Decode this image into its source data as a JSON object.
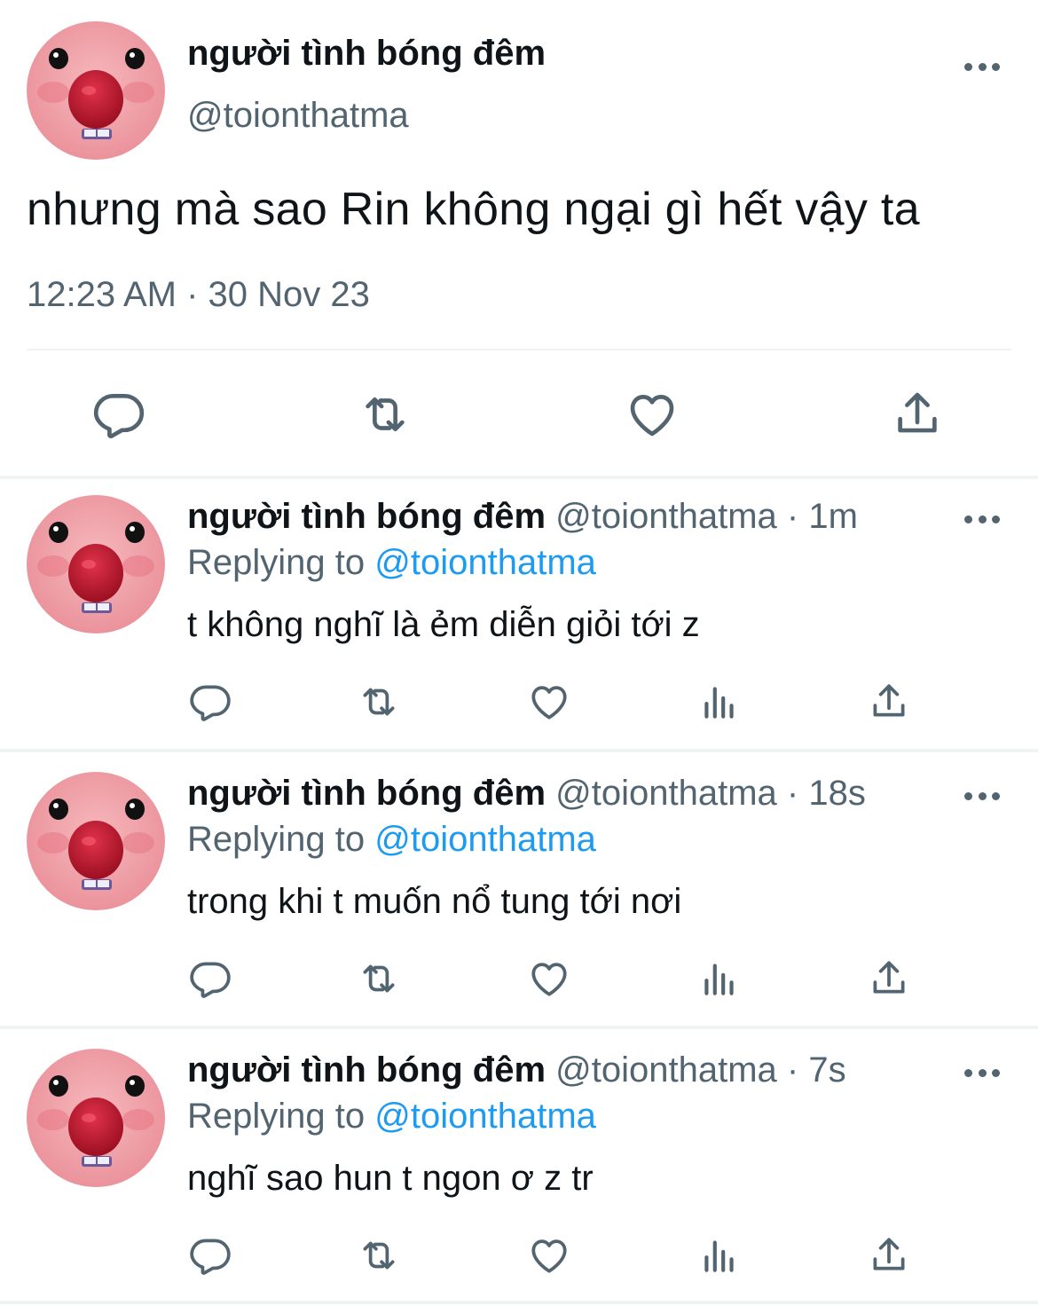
{
  "main_tweet": {
    "display_name": "người tình bóng đêm",
    "handle": "@toionthatma",
    "text": "nhưng mà sao Rin không ngại gì hết vậy ta",
    "timestamp": "12:23 AM · 30 Nov 23",
    "actions": [
      "reply-icon",
      "retweet-icon",
      "like-icon",
      "share-icon"
    ]
  },
  "replies": [
    {
      "display_name": "người tình bóng đêm",
      "handle": "@toionthatma",
      "separator": "·",
      "time": "1m",
      "replying_prefix": "Replying to",
      "replying_handle": "@toionthatma",
      "text": "t không nghĩ là ẻm diễn giỏi tới z"
    },
    {
      "display_name": "người tình bóng đêm",
      "handle": "@toionthatma",
      "separator": "·",
      "time": "18s",
      "replying_prefix": "Replying to",
      "replying_handle": "@toionthatma",
      "text": "trong khi t muốn nổ tung tới nơi"
    },
    {
      "display_name": "người tình bóng đêm",
      "handle": "@toionthatma",
      "separator": "·",
      "time": "7s",
      "replying_prefix": "Replying to",
      "replying_handle": "@toionthatma",
      "text": "nghĩ sao hun t ngon ơ z tr"
    }
  ],
  "reply_actions": [
    "reply-icon",
    "retweet-icon",
    "like-icon",
    "views-icon",
    "share-icon"
  ],
  "colors": {
    "text": "#0f1419",
    "secondary": "#536471",
    "link": "#1d9bf0",
    "divider": "#eff3f4"
  }
}
